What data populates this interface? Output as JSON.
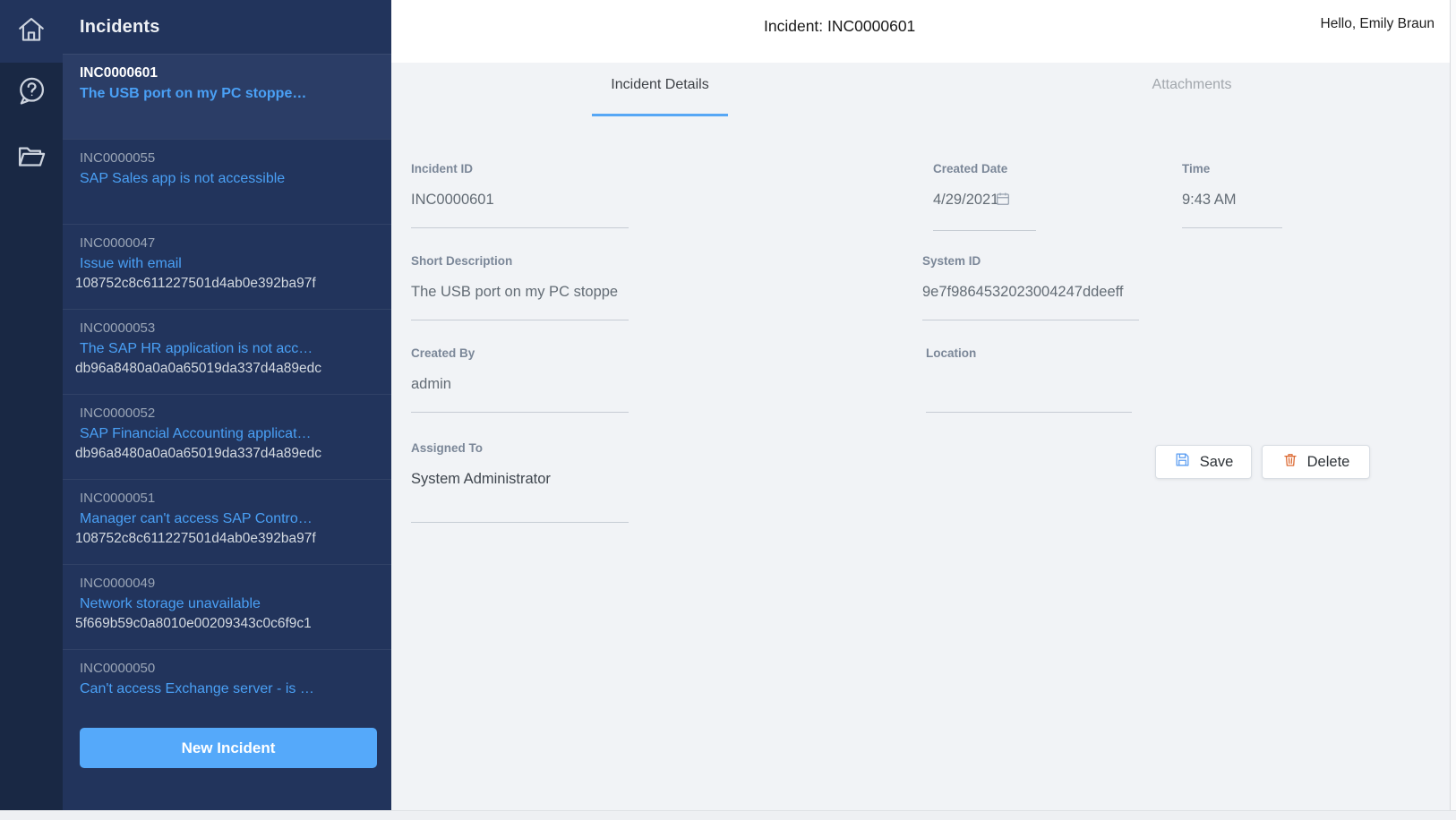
{
  "colors": {
    "rail_bg": "#192844",
    "sidebar_bg": "#22345c",
    "selected_item_bg": "#2b3d66",
    "link_blue": "#4aa0f5",
    "accent_blue": "#55a9fa",
    "tab_underline": "#57a7f5",
    "content_bg": "#f1f3f6",
    "save_icon": "#5b9df2",
    "delete_icon": "#dc6a33"
  },
  "icon_rail": {
    "icons": [
      {
        "name": "home"
      },
      {
        "name": "help"
      },
      {
        "name": "folder"
      }
    ]
  },
  "sidebar": {
    "title": "Incidents",
    "new_incident_button": "New Incident",
    "incidents": [
      {
        "number": "INC0000601",
        "title": "The USB port on my PC stoppe…",
        "sys_id": "",
        "selected": true
      },
      {
        "number": "INC0000055",
        "title": "SAP Sales app is not accessible",
        "sys_id": "",
        "selected": false
      },
      {
        "number": "INC0000047",
        "title": "Issue with email",
        "sys_id": "108752c8c611227501d4ab0e392ba97f",
        "selected": false
      },
      {
        "number": "INC0000053",
        "title": "The SAP HR application is not acc…",
        "sys_id": "db96a8480a0a0a65019da337d4a89edc",
        "selected": false
      },
      {
        "number": "INC0000052",
        "title": "SAP Financial Accounting applicat…",
        "sys_id": "db96a8480a0a0a65019da337d4a89edc",
        "selected": false
      },
      {
        "number": "INC0000051",
        "title": "Manager can't access SAP Contro…",
        "sys_id": "108752c8c611227501d4ab0e392ba97f",
        "selected": false
      },
      {
        "number": "INC0000049",
        "title": "Network storage unavailable",
        "sys_id": "5f669b59c0a8010e00209343c0c6f9c1",
        "selected": false
      },
      {
        "number": "INC0000050",
        "title": "Can't access Exchange server - is …",
        "sys_id": "",
        "selected": false
      }
    ]
  },
  "header": {
    "title": "Incident: INC0000601",
    "greeting": "Hello, Emily Braun"
  },
  "tabs": [
    {
      "label": "Incident Details",
      "active": true
    },
    {
      "label": "Attachments",
      "active": false
    }
  ],
  "form": {
    "incident_id": {
      "label": "Incident ID",
      "value": "INC0000601"
    },
    "short_description": {
      "label": "Short Description",
      "value": "The USB port on my PC stoppe"
    },
    "created_by": {
      "label": "Created By",
      "value": "admin"
    },
    "assigned_to": {
      "label": "Assigned To",
      "value": "System Administrator"
    },
    "created_date": {
      "label": "Created Date",
      "value": "4/29/2021"
    },
    "time": {
      "label": "Time",
      "value": "9:43 AM"
    },
    "system_id": {
      "label": "System ID",
      "value": "9e7f9864532023004247ddeeff"
    },
    "location": {
      "label": "Location",
      "value": ""
    }
  },
  "actions": {
    "save": "Save",
    "delete": "Delete"
  }
}
